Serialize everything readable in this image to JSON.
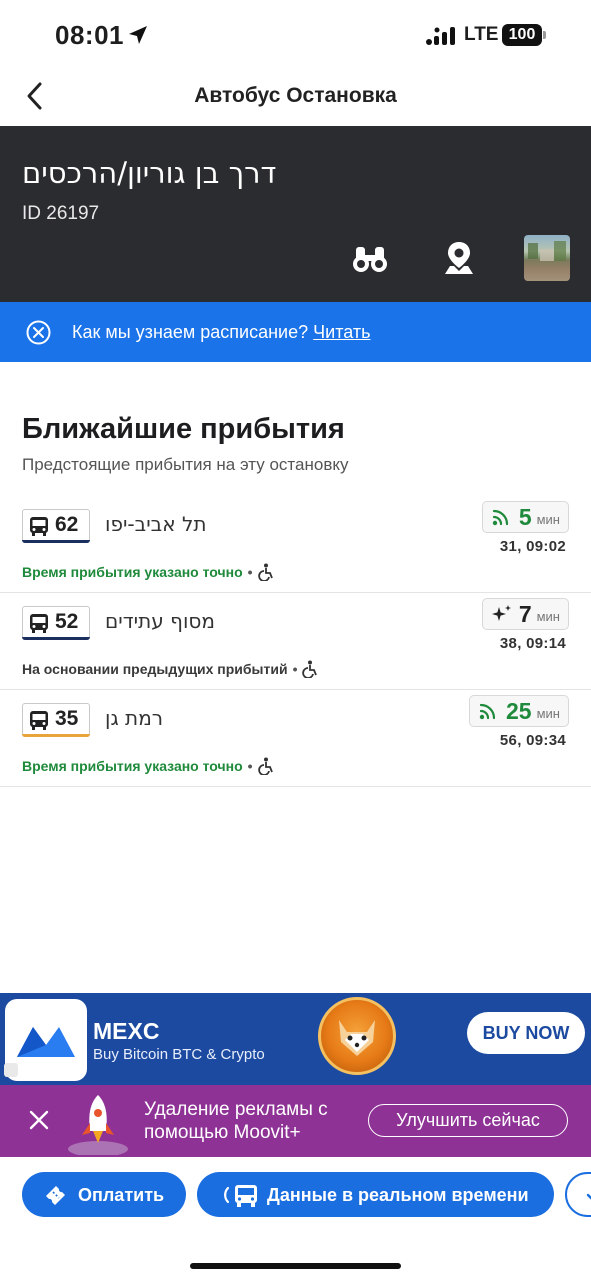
{
  "status_bar": {
    "time": "08:01",
    "network": "LTE",
    "battery": "100"
  },
  "nav": {
    "title": "Автобус Остановка"
  },
  "stop": {
    "name": "דרך בן גוריון/הרכסים",
    "id_label": "ID 26197"
  },
  "info_banner": {
    "text": "Как мы узнаем расписание?",
    "link": "Читать"
  },
  "arrivals": {
    "title": "Ближайшие прибытия",
    "subtitle": "Предстоящие прибытия на эту остановку",
    "rows": [
      {
        "line": "62",
        "destination": "תל אביב-יפו",
        "eta": "5",
        "unit": "мин",
        "times": "31, 09:02",
        "note": "Время прибытия указано точно",
        "note_status": "realtime",
        "line_color": "#1b2f5e"
      },
      {
        "line": "52",
        "destination": "מסוף עתידים",
        "eta": "7",
        "unit": "мин",
        "times": "38, 09:14",
        "note": "На основании предыдущих прибытий",
        "note_status": "estimated",
        "line_color": "#1b2f5e"
      },
      {
        "line": "35",
        "destination": "רמת גן",
        "eta": "25",
        "unit": "мин",
        "times": "56, 09:34",
        "note": "Время прибытия указано точно",
        "note_status": "realtime",
        "line_color": "#e8a33a"
      }
    ]
  },
  "ad": {
    "brand": "MEXC",
    "tagline": "Buy Bitcoin BTC & Crypto",
    "cta": "BUY NOW"
  },
  "promo": {
    "line1": "Удаление рекламы с",
    "line2": "помощью Moovit+",
    "cta": "Улучшить сейчас"
  },
  "bottom_actions": {
    "pay": "Оплатить",
    "realtime": "Данные в реальном времени"
  },
  "colors": {
    "header_bg": "#2b2c2f",
    "accent_blue": "#1a73e8",
    "realtime_green": "#1f8a3b",
    "promo_purple": "#8e3295",
    "ad_blue": "#1c4aa0"
  }
}
